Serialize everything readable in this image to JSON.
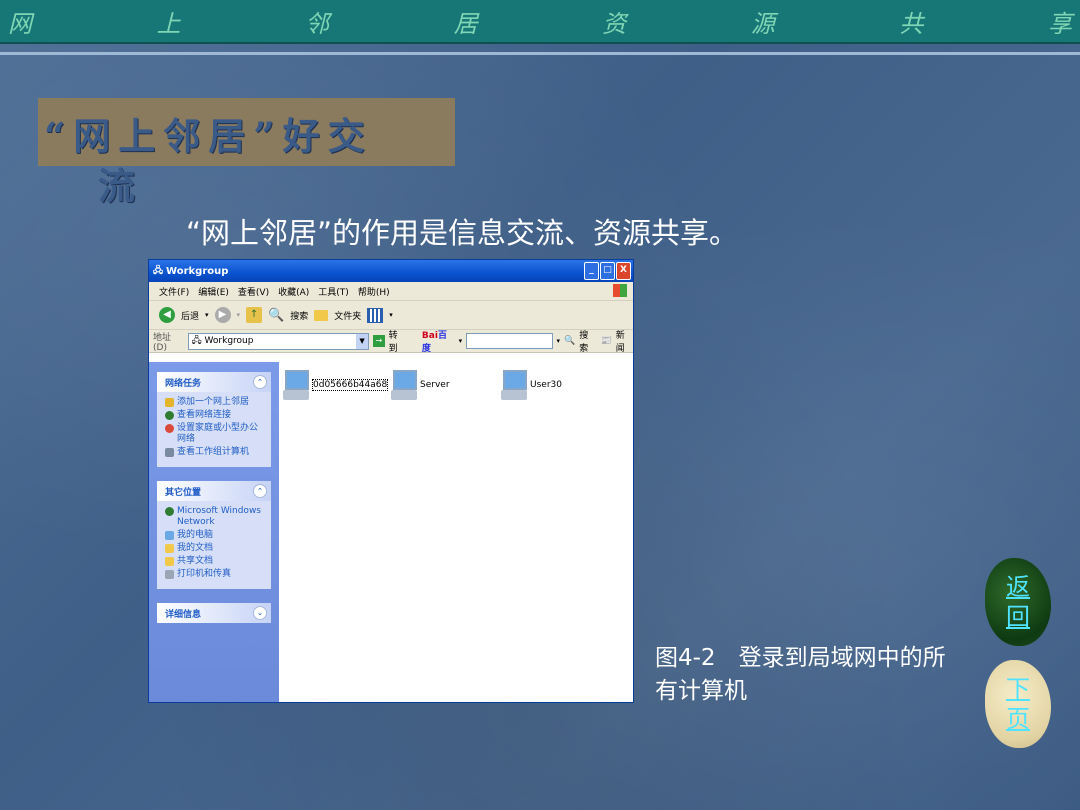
{
  "header": {
    "chars": [
      "网",
      "上",
      "邻",
      "居",
      "资",
      "源",
      "共",
      "享"
    ]
  },
  "slide": {
    "title_line1": "“网上邻居”好交",
    "title_line2": "流",
    "subtitle": "“网上邻居”的作用是信息交流、资源共享。",
    "caption": "图4-2　登录到局域网中的所有计算机"
  },
  "window": {
    "title": "Workgroup",
    "buttons": [
      "_",
      "□",
      "X"
    ],
    "menu": [
      "文件(F)",
      "编辑(E)",
      "查看(V)",
      "收藏(A)",
      "工具(T)",
      "帮助(H)"
    ],
    "toolbar": {
      "back": "后退",
      "search": "搜索",
      "folders": "文件夹"
    },
    "address": {
      "label": "地址(D)",
      "value": "Workgroup",
      "go": "转到"
    },
    "baidu": {
      "logo": "Bai",
      "logo2": "百度",
      "search": "搜索",
      "news": "新闻"
    },
    "tasks": {
      "title": "网络任务",
      "items": [
        "添加一个网上邻居",
        "查看网络连接",
        "设置家庭或小型办公网络",
        "查看工作组计算机"
      ]
    },
    "places": {
      "title": "其它位置",
      "items": [
        "Microsoft Windows Network",
        "我的电脑",
        "我的文档",
        "共享文档",
        "打印机和传真"
      ]
    },
    "details": {
      "title": "详细信息"
    },
    "computers": [
      "0d05666b44a68",
      "Server",
      "User30"
    ]
  },
  "nav": {
    "back_label": "返回",
    "back_line1": "返",
    "back_line2": "回",
    "next_line1": "下",
    "next_line2": "页"
  },
  "colors": {
    "topbar": "#177777",
    "title_box": "#8b7b5e",
    "link": "#4fe3ff"
  }
}
